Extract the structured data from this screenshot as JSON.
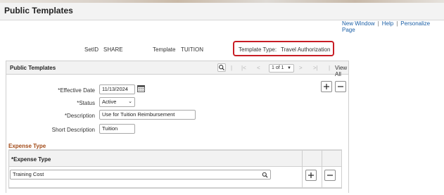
{
  "page": {
    "title": "Public Templates"
  },
  "links": {
    "new_window": "New Window",
    "help": "Help",
    "personalize": "Personalize Page",
    "sep": "|"
  },
  "header": {
    "setid_label": "SetID",
    "setid_value": "SHARE",
    "template_label": "Template",
    "template_value": "TUITION",
    "template_type_label": "Template Type:",
    "template_type_value": "Travel Authorization"
  },
  "panel": {
    "title": "Public Templates",
    "nav": {
      "first": "|<",
      "prev": "<",
      "page": "1 of 1",
      "next": ">",
      "last": ">|",
      "sep": "|",
      "view_all": "View All"
    },
    "fields": {
      "effective_date_label": "*Effective Date",
      "effective_date_value": "11/13/2024",
      "status_label": "*Status",
      "status_value": "Active",
      "description_label": "*Description",
      "description_value": "Use for Tuition Reimbursement",
      "short_description_label": "Short Description",
      "short_description_value": "Tuition"
    }
  },
  "expense": {
    "section_title": "Expense Type",
    "column_header": "*Expense Type",
    "rows": [
      {
        "expense_type": "Training Cost"
      }
    ]
  },
  "icons": [
    "search-icon",
    "calendar-icon",
    "chevron-down-icon",
    "plus-icon",
    "minus-icon"
  ],
  "colors": {
    "highlight_border": "#c81d25",
    "section_title": "#a24a17",
    "link": "#1b5fa6"
  }
}
